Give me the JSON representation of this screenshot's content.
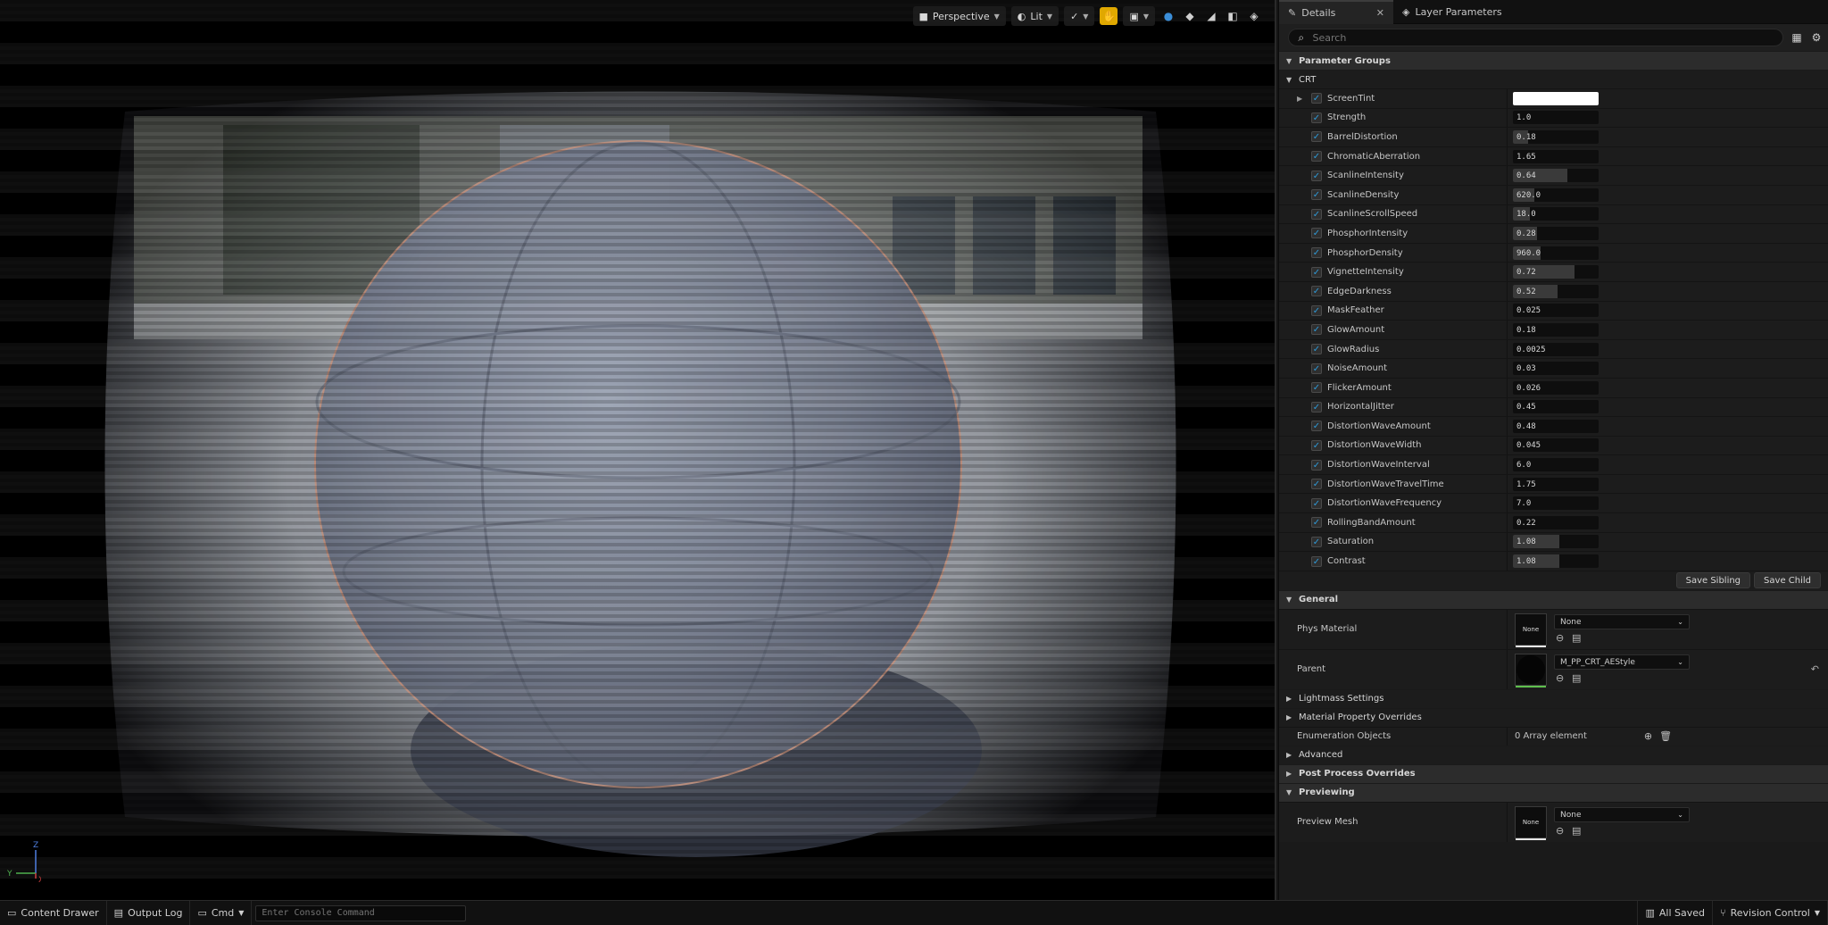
{
  "viewport": {
    "view_mode": "Perspective",
    "lighting_mode": "Lit",
    "axis": {
      "z": "Z",
      "y": "Y",
      "x": "X"
    }
  },
  "tabs": {
    "details": "Details",
    "layer_parameters": "Layer Parameters"
  },
  "search": {
    "placeholder": "Search"
  },
  "parameter_groups": {
    "label": "Parameter Groups",
    "group": "CRT",
    "params": [
      {
        "name": "ScreenTint",
        "type": "color",
        "color": "#ffffff"
      },
      {
        "name": "Strength",
        "value": "1.0",
        "fill": 0.0
      },
      {
        "name": "BarrelDistortion",
        "value": "0.18",
        "fill": 0.18
      },
      {
        "name": "ChromaticAberration",
        "value": "1.65",
        "fill": 0.0
      },
      {
        "name": "ScanlineIntensity",
        "value": "0.64",
        "fill": 0.64
      },
      {
        "name": "ScanlineDensity",
        "value": "620.0",
        "fill": 0.25
      },
      {
        "name": "ScanlineScrollSpeed",
        "value": "18.0",
        "fill": 0.2
      },
      {
        "name": "PhosphorIntensity",
        "value": "0.28",
        "fill": 0.28
      },
      {
        "name": "PhosphorDensity",
        "value": "960.0",
        "fill": 0.32
      },
      {
        "name": "VignetteIntensity",
        "value": "0.72",
        "fill": 0.72
      },
      {
        "name": "EdgeDarkness",
        "value": "0.52",
        "fill": 0.52
      },
      {
        "name": "MaskFeather",
        "value": "0.025",
        "fill": 0.0
      },
      {
        "name": "GlowAmount",
        "value": "0.18",
        "fill": 0.0
      },
      {
        "name": "GlowRadius",
        "value": "0.0025",
        "fill": 0.0
      },
      {
        "name": "NoiseAmount",
        "value": "0.03",
        "fill": 0.0
      },
      {
        "name": "FlickerAmount",
        "value": "0.026",
        "fill": 0.0
      },
      {
        "name": "HorizontalJitter",
        "value": "0.45",
        "fill": 0.0
      },
      {
        "name": "DistortionWaveAmount",
        "value": "0.48",
        "fill": 0.0
      },
      {
        "name": "DistortionWaveWidth",
        "value": "0.045",
        "fill": 0.0
      },
      {
        "name": "DistortionWaveInterval",
        "value": "6.0",
        "fill": 0.0
      },
      {
        "name": "DistortionWaveTravelTime",
        "value": "1.75",
        "fill": 0.0
      },
      {
        "name": "DistortionWaveFrequency",
        "value": "7.0",
        "fill": 0.0
      },
      {
        "name": "RollingBandAmount",
        "value": "0.22",
        "fill": 0.0
      },
      {
        "name": "Saturation",
        "value": "1.08",
        "fill": 0.54
      },
      {
        "name": "Contrast",
        "value": "1.08",
        "fill": 0.54
      }
    ]
  },
  "buttons": {
    "save_sibling": "Save Sibling",
    "save_child": "Save Child"
  },
  "general": {
    "label": "General",
    "phys_material": {
      "label": "Phys Material",
      "thumb": "None",
      "value": "None"
    },
    "parent": {
      "label": "Parent",
      "value": "M_PP_CRT_AEStyle"
    },
    "lightmass": "Lightmass Settings",
    "material_overrides": "Material Property Overrides",
    "enumeration": {
      "label": "Enumeration Objects",
      "value": "0 Array element"
    },
    "advanced": "Advanced"
  },
  "post_process": {
    "label": "Post Process Overrides"
  },
  "previewing": {
    "label": "Previewing",
    "preview_mesh": {
      "label": "Preview Mesh",
      "thumb": "None",
      "value": "None"
    }
  },
  "statusbar": {
    "content_drawer": "Content Drawer",
    "output_log": "Output Log",
    "cmd": "Cmd",
    "console_placeholder": "Enter Console Command",
    "all_saved": "All Saved",
    "revision_control": "Revision Control"
  }
}
